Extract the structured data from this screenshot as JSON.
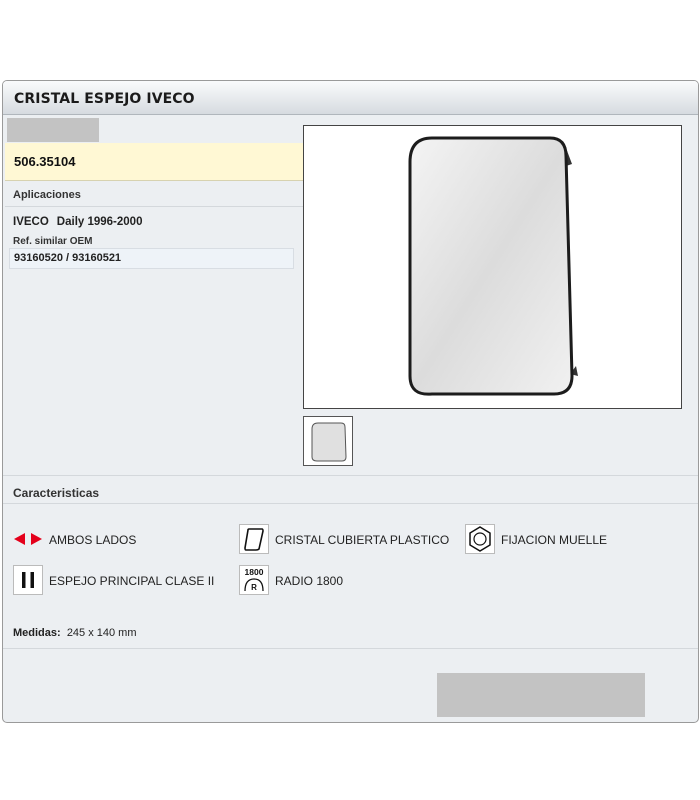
{
  "window": {
    "title": "CRISTAL ESPEJO IVECO"
  },
  "product": {
    "ref_code": "506.35104",
    "applications_label": "Aplicaciones",
    "brand": "IVECO",
    "model": "Daily 1996-2000",
    "oem_label": "Ref. similar OEM",
    "oem_refs": "93160520 / 93160521"
  },
  "features": {
    "heading": "Caracteristicas",
    "items": [
      {
        "icon": "arrows-both-sides-icon",
        "label": "AMBOS LADOS"
      },
      {
        "icon": "glass-plastic-cover-icon",
        "label": "CRISTAL CUBIERTA PLASTICO"
      },
      {
        "icon": "hex-spring-fixing-icon",
        "label": "FIJACION MUELLE"
      },
      {
        "icon": "class-ii-icon",
        "label": "ESPEJO PRINCIPAL CLASE II"
      },
      {
        "icon": "radius-1800-icon",
        "label": "RADIO 1800",
        "icon_text_top": "1800",
        "icon_text_bottom": "R"
      }
    ]
  },
  "measures": {
    "label": "Medidas:",
    "value": "245 x 140 mm"
  },
  "colors": {
    "accent_red": "#e4001b",
    "ref_bar": "#fff8d4",
    "panel_bg": "#eceff2"
  }
}
